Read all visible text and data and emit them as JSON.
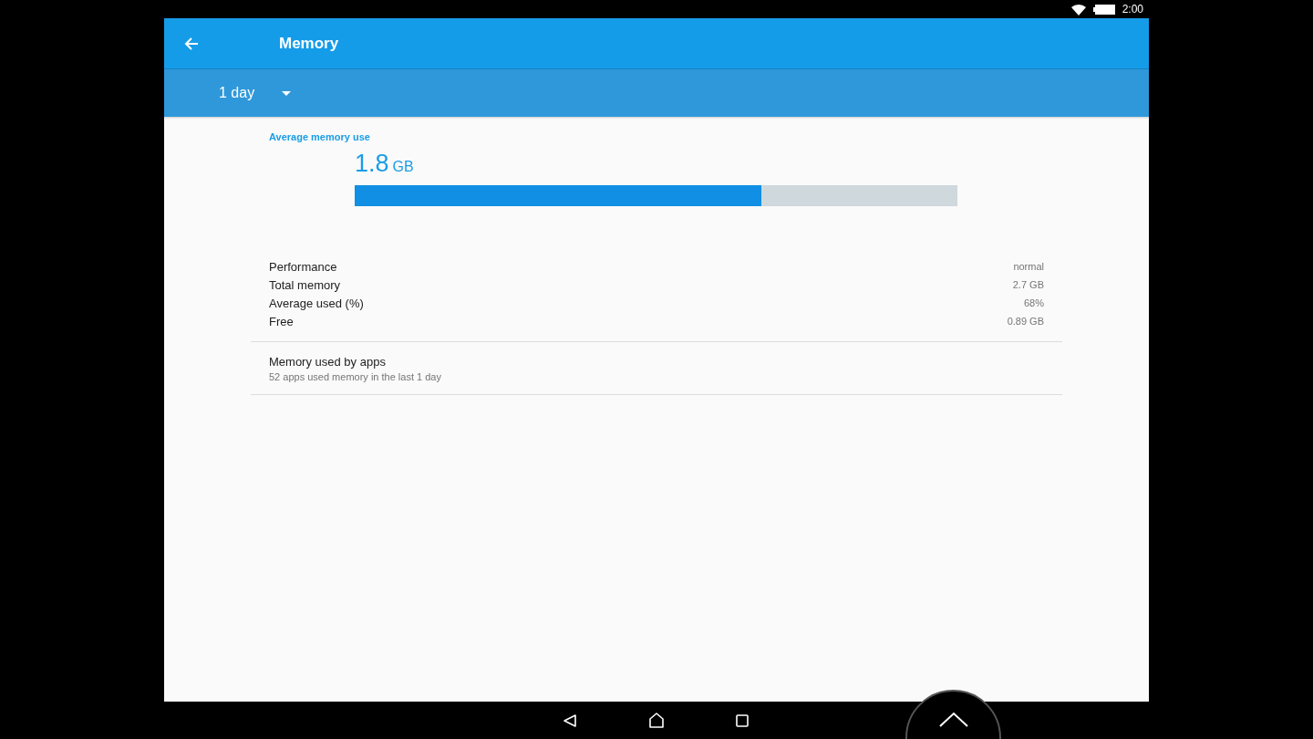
{
  "status_bar": {
    "time": "2:00"
  },
  "toolbar": {
    "title": "Memory"
  },
  "period": {
    "value": "1 day"
  },
  "summary": {
    "label": "Average memory use",
    "value": "1.8",
    "unit": "GB",
    "level": 0.675
  },
  "stats": [
    {
      "label": "Performance",
      "value": "normal"
    },
    {
      "label": "Total memory",
      "value": "2.7 GB"
    },
    {
      "label": "Average used (%)",
      "value": "68%"
    },
    {
      "label": "Free",
      "value": "0.89 GB"
    }
  ],
  "apps_item": {
    "title": "Memory used by apps",
    "subtitle": "52 apps used memory in the last 1 day"
  }
}
